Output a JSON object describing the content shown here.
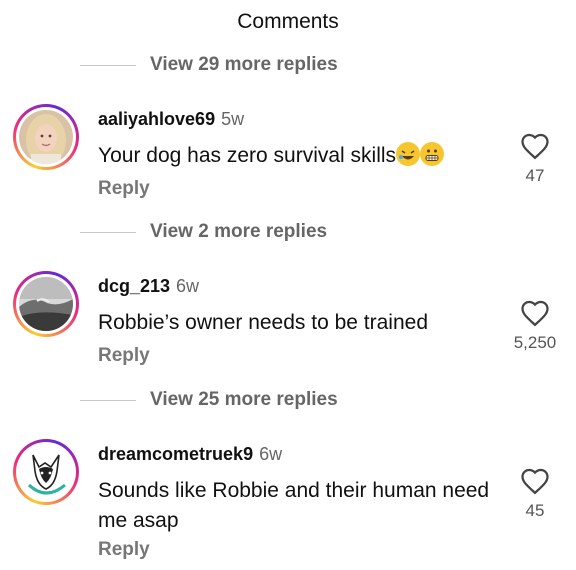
{
  "header": {
    "title": "Comments"
  },
  "replies": [
    {
      "label": "View 29 more replies"
    },
    {
      "label": "View 2 more replies"
    },
    {
      "label": "View 25 more replies"
    }
  ],
  "comments": [
    {
      "username": "aaliyahlove69",
      "time": "5w",
      "text": "Your dog has zero survival skills",
      "reply": "Reply",
      "likes": "47",
      "emojis": [
        "rofl-emoji",
        "grimacing-emoji"
      ]
    },
    {
      "username": "dcg_213",
      "time": "6w",
      "text": "Robbie’s owner needs to be trained",
      "reply": "Reply",
      "likes": "5,250"
    },
    {
      "username": "dreamcometruek9",
      "time": "6w",
      "text": "Sounds like Robbie and their human need me asap",
      "reply": "Reply",
      "likes": "45"
    }
  ],
  "icons": {
    "like": "heart-outline-icon"
  },
  "colors": {
    "text": "#111111",
    "secondary": "#666666",
    "story_ring": [
      "#f9ce34",
      "#ee2a7b",
      "#6228d7"
    ]
  }
}
